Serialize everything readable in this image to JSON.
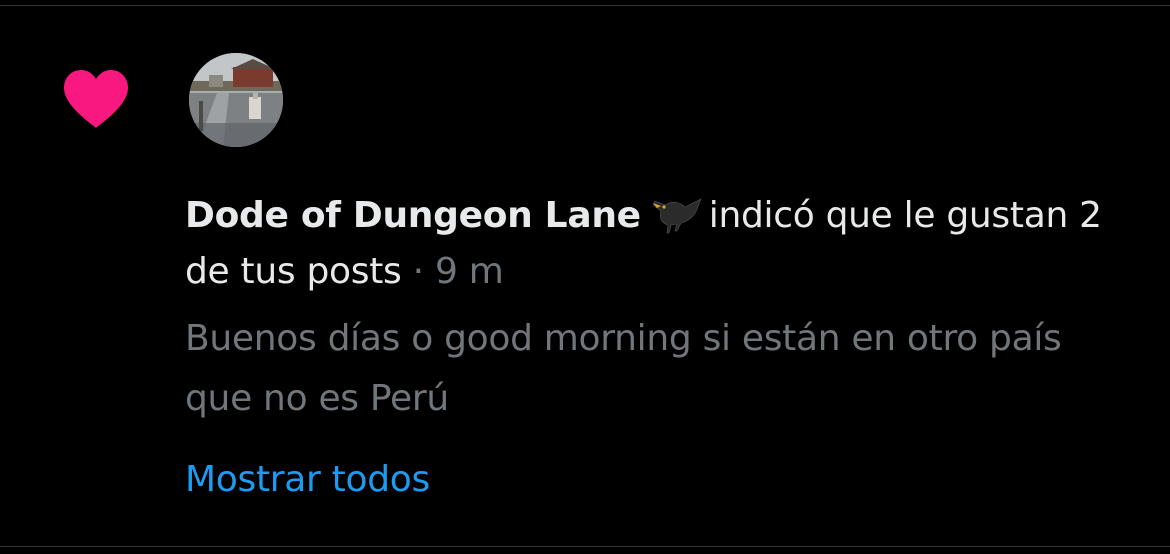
{
  "notification": {
    "icon": "heart-icon",
    "icon_color": "#f91880",
    "avatar": "user-avatar-photo",
    "author_name": "Dode of Dungeon Lane",
    "author_emoji": "blackbird-emoji",
    "action_text": "indicó que le gustan 2 de tus posts",
    "separator": "·",
    "time": "9 m",
    "post_preview": "Buenos días o good morning si están en otro país que no es Perú",
    "show_all_label": "Mostrar todos"
  },
  "colors": {
    "background": "#000000",
    "primary_text": "#e7e9ea",
    "secondary_text": "#71767b",
    "link": "#1d9bf0",
    "divider": "#2f3336"
  }
}
